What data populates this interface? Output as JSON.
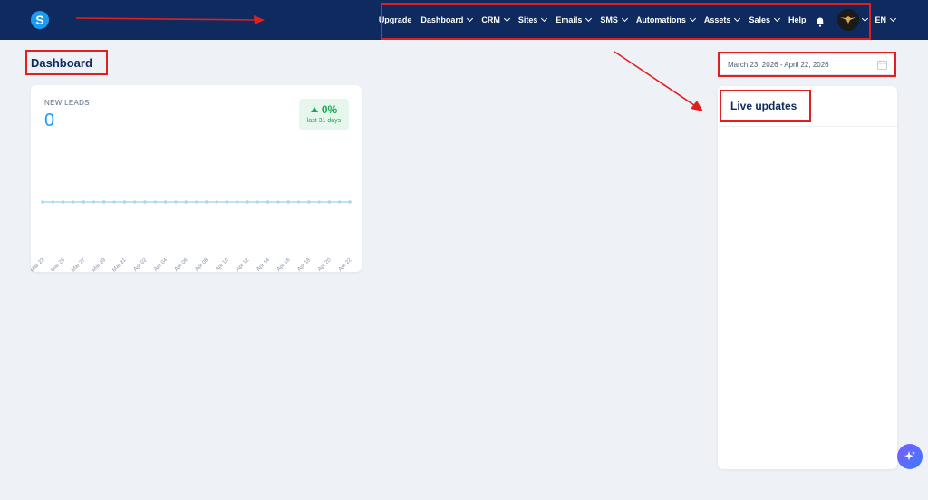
{
  "nav": {
    "logo": "S",
    "items": [
      {
        "label": "Upgrade",
        "dropdown": false
      },
      {
        "label": "Dashboard",
        "dropdown": true
      },
      {
        "label": "CRM",
        "dropdown": true
      },
      {
        "label": "Sites",
        "dropdown": true
      },
      {
        "label": "Emails",
        "dropdown": true
      },
      {
        "label": "SMS",
        "dropdown": true
      },
      {
        "label": "Automations",
        "dropdown": true
      },
      {
        "label": "Assets",
        "dropdown": true
      },
      {
        "label": "Sales",
        "dropdown": true
      },
      {
        "label": "Help",
        "dropdown": false
      }
    ],
    "language": "EN"
  },
  "page": {
    "title": "Dashboard"
  },
  "date_range": "March 23, 2026 - April 22, 2026",
  "leads_card": {
    "label": "NEW LEADS",
    "value": "0",
    "trend_pct": "0%",
    "trend_sub": "last 31 days"
  },
  "chart_data": {
    "type": "line",
    "x": [
      "Mar 23",
      "Mar 25",
      "Mar 27",
      "Mar 29",
      "Mar 31",
      "Apr 02",
      "Apr 04",
      "Apr 06",
      "Apr 08",
      "Apr 10",
      "Apr 12",
      "Apr 14",
      "Apr 16",
      "Apr 18",
      "Apr 20",
      "Apr 22"
    ],
    "series": [
      {
        "values": [
          0,
          0,
          0,
          0,
          0,
          0,
          0,
          0,
          0,
          0,
          0,
          0,
          0,
          0,
          0,
          0
        ]
      }
    ],
    "color": "#a8d8f5"
  },
  "live_updates": {
    "title": "Live updates"
  },
  "colors": {
    "nav_bg": "#0f2a5e",
    "accent": "#1d9bf0",
    "positive": "#18a852",
    "annotation": "#e02020"
  }
}
